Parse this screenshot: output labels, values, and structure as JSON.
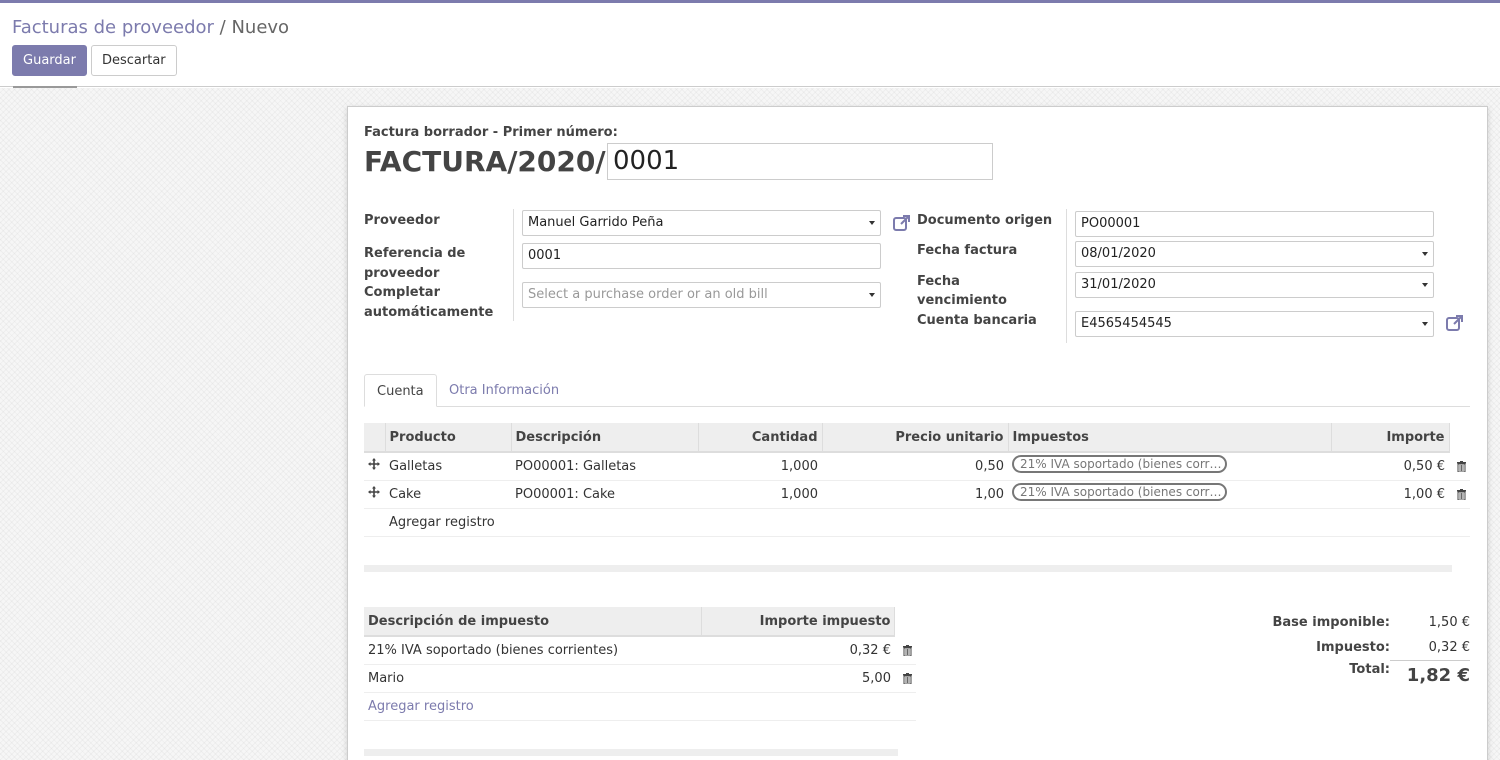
{
  "breadcrumb": {
    "parent": "Facturas de proveedor",
    "separator": " / ",
    "current": "Nuevo"
  },
  "buttons": {
    "save": "Guardar",
    "discard": "Descartar"
  },
  "header": {
    "draft_label": "Factura borrador - Primer número:",
    "prefix": "FACTURA/2020/",
    "number": "0001"
  },
  "left_fields": {
    "vendor_label": "Proveedor",
    "vendor_value": "Manuel Garrido Peña",
    "ref_label_1": "Referencia de",
    "ref_label_2": "proveedor",
    "ref_value": "0001",
    "autocomplete_label_1": "Completar",
    "autocomplete_label_2": "automáticamente",
    "autocomplete_placeholder": "Select a purchase order or an old bill"
  },
  "right_fields": {
    "origin_label": "Documento origen",
    "origin_value": "PO00001",
    "invoice_date_label": "Fecha factura",
    "invoice_date_value": "08/01/2020",
    "due_label_1": "Fecha",
    "due_label_2": "vencimiento",
    "due_value": "31/01/2020",
    "bank_label": "Cuenta bancaria",
    "bank_value": "E4565454545"
  },
  "tabs": [
    {
      "label": "Cuenta"
    },
    {
      "label": "Otra Información"
    }
  ],
  "lines": {
    "headers": [
      "Producto",
      "Descripción",
      "Cantidad",
      "Precio unitario",
      "Impuestos",
      "Importe"
    ],
    "rows": [
      {
        "product": "Galletas",
        "description": "PO00001: Galletas",
        "qty": "1,000",
        "price": "0,50",
        "tax": "21% IVA soportado (bienes corr…",
        "amount": "0,50 €"
      },
      {
        "product": "Cake",
        "description": "PO00001: Cake",
        "qty": "1,000",
        "price": "1,00",
        "tax": "21% IVA soportado (bienes corr…",
        "amount": "1,00 €"
      }
    ],
    "add": "Agregar registro"
  },
  "taxes": {
    "headers": [
      "Descripción de impuesto",
      "Importe impuesto"
    ],
    "rows": [
      {
        "name": "21% IVA soportado (bienes corrientes)",
        "amount": "0,32 €"
      },
      {
        "name": "Mario",
        "amount": "5,00"
      }
    ],
    "add": "Agregar registro"
  },
  "totals": {
    "base_label": "Base imponible:",
    "base_value": "1,50 €",
    "tax_label": "Impuesto:",
    "tax_value": "0,32 €",
    "total_label": "Total:",
    "total_value": "1,82 €"
  }
}
